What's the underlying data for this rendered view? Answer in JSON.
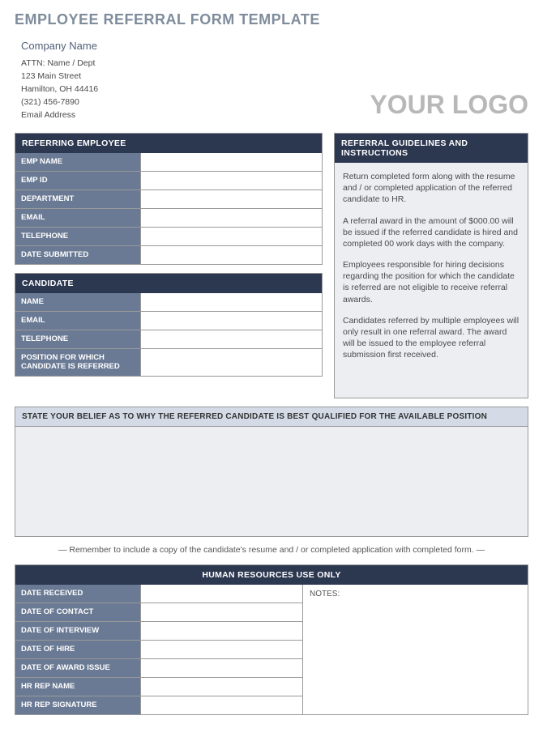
{
  "title": "EMPLOYEE REFERRAL FORM TEMPLATE",
  "company": {
    "name": "Company Name",
    "attn": "ATTN: Name / Dept",
    "street": "123 Main Street",
    "city": "Hamilton, OH  44416",
    "phone": "(321) 456-7890",
    "email": "Email Address"
  },
  "logo": "YOUR LOGO",
  "referring": {
    "header": "REFERRING EMPLOYEE",
    "fields": [
      {
        "label": "EMP NAME",
        "value": ""
      },
      {
        "label": "EMP ID",
        "value": ""
      },
      {
        "label": "DEPARTMENT",
        "value": ""
      },
      {
        "label": "EMAIL",
        "value": ""
      },
      {
        "label": "TELEPHONE",
        "value": ""
      },
      {
        "label": "DATE SUBMITTED",
        "value": ""
      }
    ]
  },
  "candidate": {
    "header": "CANDIDATE",
    "fields": [
      {
        "label": "NAME",
        "value": ""
      },
      {
        "label": "EMAIL",
        "value": ""
      },
      {
        "label": "TELEPHONE",
        "value": ""
      },
      {
        "label": "POSITION FOR WHICH CANDIDATE IS REFERRED",
        "value": ""
      }
    ]
  },
  "guidelines": {
    "header": "REFERRAL GUIDELINES AND INSTRUCTIONS",
    "p1": "Return completed form along with the resume and / or completed application of the referred candidate to HR.",
    "p2": "A referral award in the amount of $000.00 will be issued if the referred candidate is hired and completed 00 work days with the company.",
    "p3": "Employees responsible for hiring decisions regarding the position for which the candidate is referred are not eligible to receive referral awards.",
    "p4": "Candidates referred by multiple employees will only result in one referral award.  The award will be issued to the employee referral submission first received."
  },
  "belief": {
    "header": "STATE YOUR BELIEF AS TO WHY THE REFERRED CANDIDATE IS BEST QUALIFIED FOR THE AVAILABLE POSITION",
    "value": ""
  },
  "reminder": "— Remember to include a copy of the candidate's resume and / or completed application with completed form. —",
  "hr": {
    "header": "HUMAN RESOURCES USE ONLY",
    "notes_label": "NOTES:",
    "notes_value": "",
    "fields": [
      {
        "label": "DATE RECEIVED",
        "value": ""
      },
      {
        "label": "DATE OF CONTACT",
        "value": ""
      },
      {
        "label": "DATE OF INTERVIEW",
        "value": ""
      },
      {
        "label": "DATE OF HIRE",
        "value": ""
      },
      {
        "label": "DATE OF AWARD ISSUE",
        "value": ""
      },
      {
        "label": "HR REP NAME",
        "value": ""
      },
      {
        "label": "HR REP SIGNATURE",
        "value": ""
      }
    ]
  }
}
